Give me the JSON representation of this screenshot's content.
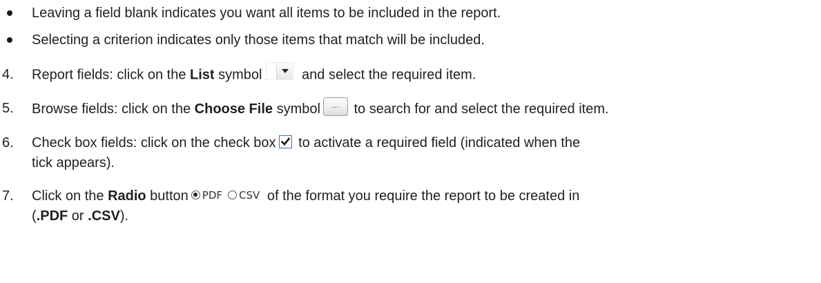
{
  "bullets": [
    "Leaving a field blank indicates you want all items to be included in the report.",
    "Selecting a criterion indicates only those items that match will be included."
  ],
  "steps": {
    "s4": {
      "num": "4.",
      "pre": "Report fields: click on the ",
      "bold": "List",
      "mid": " symbol",
      "post": " and select the required item.",
      "icon": "dropdown-arrow-icon"
    },
    "s5": {
      "num": "5.",
      "pre": "Browse fields: click on the ",
      "bold": "Choose File",
      "mid": " symbol",
      "post": " to search for and select the required item.",
      "icon_text": "...",
      "icon": "browse-ellipsis-icon"
    },
    "s6": {
      "num": "6.",
      "pre": "Check box fields: click on the check box",
      "post": " to activate a required field (indicated when the",
      "cont": "tick appears).",
      "icon": "checked-checkbox-icon"
    },
    "s7": {
      "num": "7.",
      "pre": "Click on the ",
      "bold": "Radio",
      "mid": " button",
      "radio_pdf": "PDF",
      "radio_csv": "CSV",
      "post": " of the format you require the report to be created in",
      "cont_open": "(",
      "cont_b1": ".PDF",
      "cont_or": " or ",
      "cont_b2": ".CSV",
      "cont_close": ").",
      "icon": "radio-button-icon"
    }
  },
  "colors": {
    "text": "#1f1f1f",
    "checkbox_border": "#3a6fb0",
    "checkmark": "#1a1a1a"
  }
}
